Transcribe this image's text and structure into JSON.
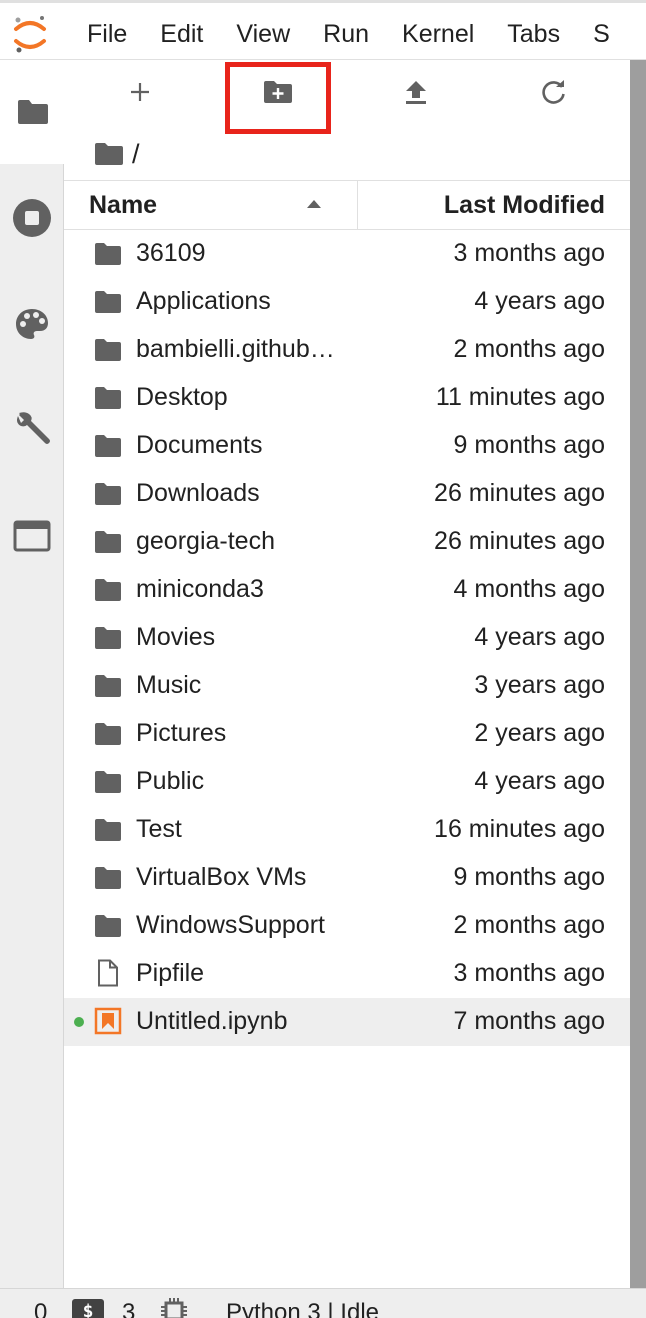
{
  "app": {
    "name": "JupyterLab",
    "colors": {
      "accent": "#f37626",
      "icon": "#616161",
      "highlight": "#e8241b",
      "running": "#4caf50"
    }
  },
  "menu": {
    "items": [
      "File",
      "Edit",
      "View",
      "Run",
      "Kernel",
      "Tabs",
      "S"
    ]
  },
  "sidebar": {
    "tabs": [
      {
        "icon": "folder-icon",
        "active": true
      },
      {
        "icon": "stop-circle-icon",
        "active": false
      },
      {
        "icon": "palette-icon",
        "active": false
      },
      {
        "icon": "wrench-icon",
        "active": false
      },
      {
        "icon": "tab-window-icon",
        "active": false
      }
    ]
  },
  "toolbar": {
    "buttons": [
      {
        "icon": "plus-icon",
        "symbol": "+"
      },
      {
        "icon": "new-folder-icon",
        "highlighted": true
      },
      {
        "icon": "upload-icon"
      },
      {
        "icon": "refresh-icon"
      }
    ]
  },
  "breadcrumb": {
    "separator": "/"
  },
  "table": {
    "columns": {
      "name": "Name",
      "modified": "Last Modified"
    },
    "rows": [
      {
        "name": "36109",
        "modified": "3 months ago",
        "type": "folder"
      },
      {
        "name": "Applications",
        "modified": "4 years ago",
        "type": "folder"
      },
      {
        "name": "bambielli.github…",
        "modified": "2 months ago",
        "type": "folder"
      },
      {
        "name": "Desktop",
        "modified": "11 minutes ago",
        "type": "folder"
      },
      {
        "name": "Documents",
        "modified": "9 months ago",
        "type": "folder"
      },
      {
        "name": "Downloads",
        "modified": "26 minutes ago",
        "type": "folder"
      },
      {
        "name": "georgia-tech",
        "modified": "26 minutes ago",
        "type": "folder"
      },
      {
        "name": "miniconda3",
        "modified": "4 months ago",
        "type": "folder"
      },
      {
        "name": "Movies",
        "modified": "4 years ago",
        "type": "folder"
      },
      {
        "name": "Music",
        "modified": "3 years ago",
        "type": "folder"
      },
      {
        "name": "Pictures",
        "modified": "2 years ago",
        "type": "folder"
      },
      {
        "name": "Public",
        "modified": "4 years ago",
        "type": "folder"
      },
      {
        "name": "Test",
        "modified": "16 minutes ago",
        "type": "folder"
      },
      {
        "name": "VirtualBox VMs",
        "modified": "9 months ago",
        "type": "folder"
      },
      {
        "name": "WindowsSupport",
        "modified": "2 months ago",
        "type": "folder"
      },
      {
        "name": "Pipfile",
        "modified": "3 months ago",
        "type": "file"
      },
      {
        "name": "Untitled.ipynb",
        "modified": "7 months ago",
        "type": "notebook",
        "selected": true,
        "running": true
      }
    ]
  },
  "statusbar": {
    "terminals_count": "0",
    "terminal_badge": "$",
    "kernels_count": "3",
    "kernel_status": "Python 3 | Idle"
  }
}
